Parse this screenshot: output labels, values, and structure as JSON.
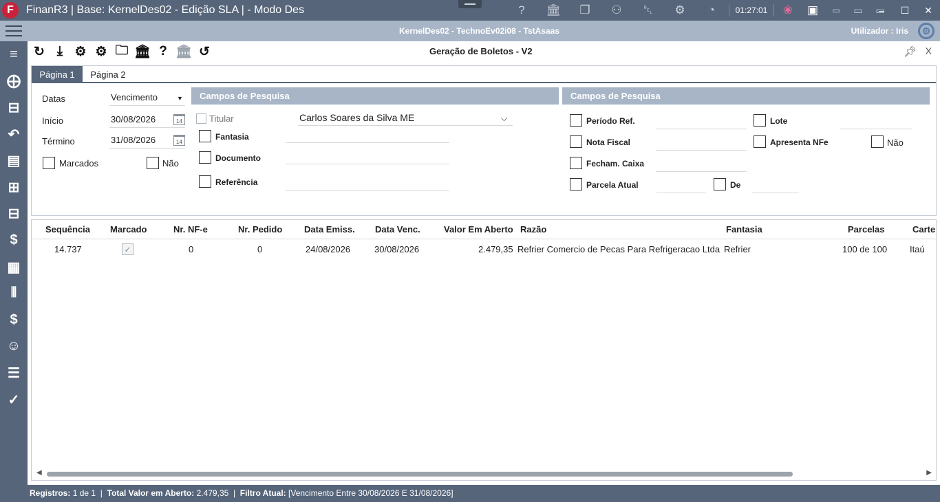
{
  "window": {
    "title": "FinanR3 | Base: KernelDes02 - Edição SLA | - Modo Des",
    "logo_letter": "F",
    "clock": "01:27:01"
  },
  "infobar": {
    "context": "KernelDes02 - TechnoEv02i08 - TstAsaas",
    "user_label": "Utilizador : Iris"
  },
  "form": {
    "title": "Geração de Boletos - V2",
    "close": "X",
    "tabs": [
      {
        "label": "Página 1"
      },
      {
        "label": "Página 2"
      }
    ]
  },
  "filters": {
    "datas_label": "Datas",
    "datas_value": "Vencimento",
    "inicio_label": "Início",
    "inicio_value": "30/08/2026",
    "termino_label": "Término",
    "termino_value": "31/08/2026",
    "marcados_label": "Marcados",
    "nao_label": "Não",
    "calendar_day": "14"
  },
  "search1": {
    "header": "Campos de Pesquisa",
    "titular_label": "Titular",
    "titular_value": "Carlos Soares da Silva ME",
    "fantasia_label": "Fantasia",
    "documento_label": "Documento",
    "referencia_label": "Referência"
  },
  "search2": {
    "header": "Campos de Pesquisa",
    "periodo_label": "Período Ref.",
    "nota_label": "Nota Fiscal",
    "fecham_label": "Fecham. Caixa",
    "parcela_label": "Parcela Atual",
    "de_label": "De",
    "lote_label": "Lote",
    "apresenta_label": "Apresenta NFe",
    "nao_label": "Não"
  },
  "grid": {
    "columns": [
      "Sequência",
      "Marcado",
      "Nr. NF-e",
      "Nr. Pedido",
      "Data Emiss.",
      "Data Venc.",
      "Valor Em Aberto",
      "Razão",
      "Fantasia",
      "Parcelas",
      "Carteira"
    ],
    "rows": [
      {
        "sequencia": "14.737",
        "marcado": true,
        "nr_nfe": "0",
        "nr_pedido": "0",
        "data_emiss": "24/08/2026",
        "data_venc": "30/08/2026",
        "valor": "2.479,35",
        "razao": "Refrier Comercio de Pecas Para Refrigeracao Ltda",
        "fantasia": "Refrier",
        "parcelas": "100 de 100",
        "carteira": "Itaú"
      }
    ]
  },
  "status": {
    "registros_label": "Registros:",
    "registros_value": "1 de 1",
    "total_label": "Total Valor em Aberto:",
    "total_value": "2.479,35",
    "filtro_label": "Filtro Atual:",
    "filtro_value": "[Vencimento Entre 30/08/2026 E 31/08/2026]"
  },
  "colors": {
    "titlebar": "#56657a",
    "infobar": "#a7b5c7",
    "section_header": "#a7b5c7",
    "logo": "#c8233b"
  }
}
